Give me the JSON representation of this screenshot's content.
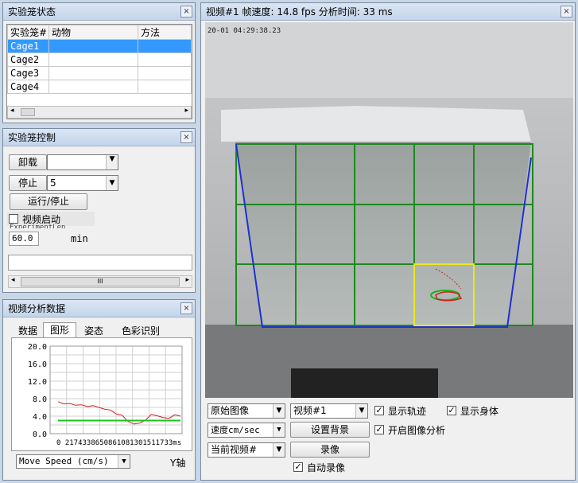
{
  "panel_status": {
    "title": "实验笼状态",
    "close": "×",
    "columns": [
      "实验笼#",
      "动物",
      "方法"
    ],
    "rows": [
      "Cage1",
      "Cage2",
      "Cage3",
      "Cage4"
    ]
  },
  "panel_control": {
    "title": "实验笼控制",
    "close": "×",
    "unload": "卸载",
    "stop": "停止",
    "stop_combo": "5",
    "run": "运行/停止",
    "video_start": "视频启动",
    "hidden_text": "ExperimentLen",
    "duration": "60.0",
    "unit": "min",
    "scroll_mark": "III"
  },
  "panel_analysis": {
    "title": "视频分析数据",
    "close": "×",
    "tabs": [
      "数据",
      "图形",
      "姿态",
      "色彩识别"
    ],
    "metric": "Move Speed (cm/s)",
    "yaxis_label": "Y轴"
  },
  "chart_data": {
    "type": "line",
    "yticks": [
      "20.0",
      "16.0",
      "12.0",
      "8.0",
      "4.0",
      "0.0"
    ],
    "ylim": [
      0,
      20
    ],
    "xlabels": "0 2174338650861081301511733ms",
    "series": [
      {
        "color": "#d42020",
        "values": [
          7.3,
          6.8,
          6.9,
          6.5,
          6.6,
          6.2,
          6.4,
          6.0,
          5.6,
          5.4,
          4.5,
          4.2,
          2.8,
          2.2,
          2.4,
          3.1,
          4.4,
          4.1,
          3.7,
          3.5,
          4.3,
          4.0
        ]
      },
      {
        "color": "#20c020",
        "values": [
          3.0,
          3.0,
          3.0,
          3.0,
          3.0,
          3.0,
          3.0,
          3.0,
          3.0,
          3.0,
          3.0,
          3.0,
          3.0,
          3.0,
          3.0,
          3.0,
          3.0,
          3.0,
          3.0,
          3.0,
          3.0,
          3.0
        ]
      }
    ]
  },
  "panel_video": {
    "title": "视频#1 帧速度: 14.8 fps  分析时间: 33 ms",
    "close": "×",
    "timestamp": "20-01 04:29:38.23",
    "image_mode": "原始图像",
    "video_select": "视频#1",
    "show_track": "显示轨迹",
    "show_body": "显示身体",
    "speed_unit": "速度cm/sec",
    "set_bg": "设置背景",
    "enable_analysis": "开启图像分析",
    "current_video": "当前视频#",
    "record": "录像",
    "auto_record": "自动录像"
  }
}
